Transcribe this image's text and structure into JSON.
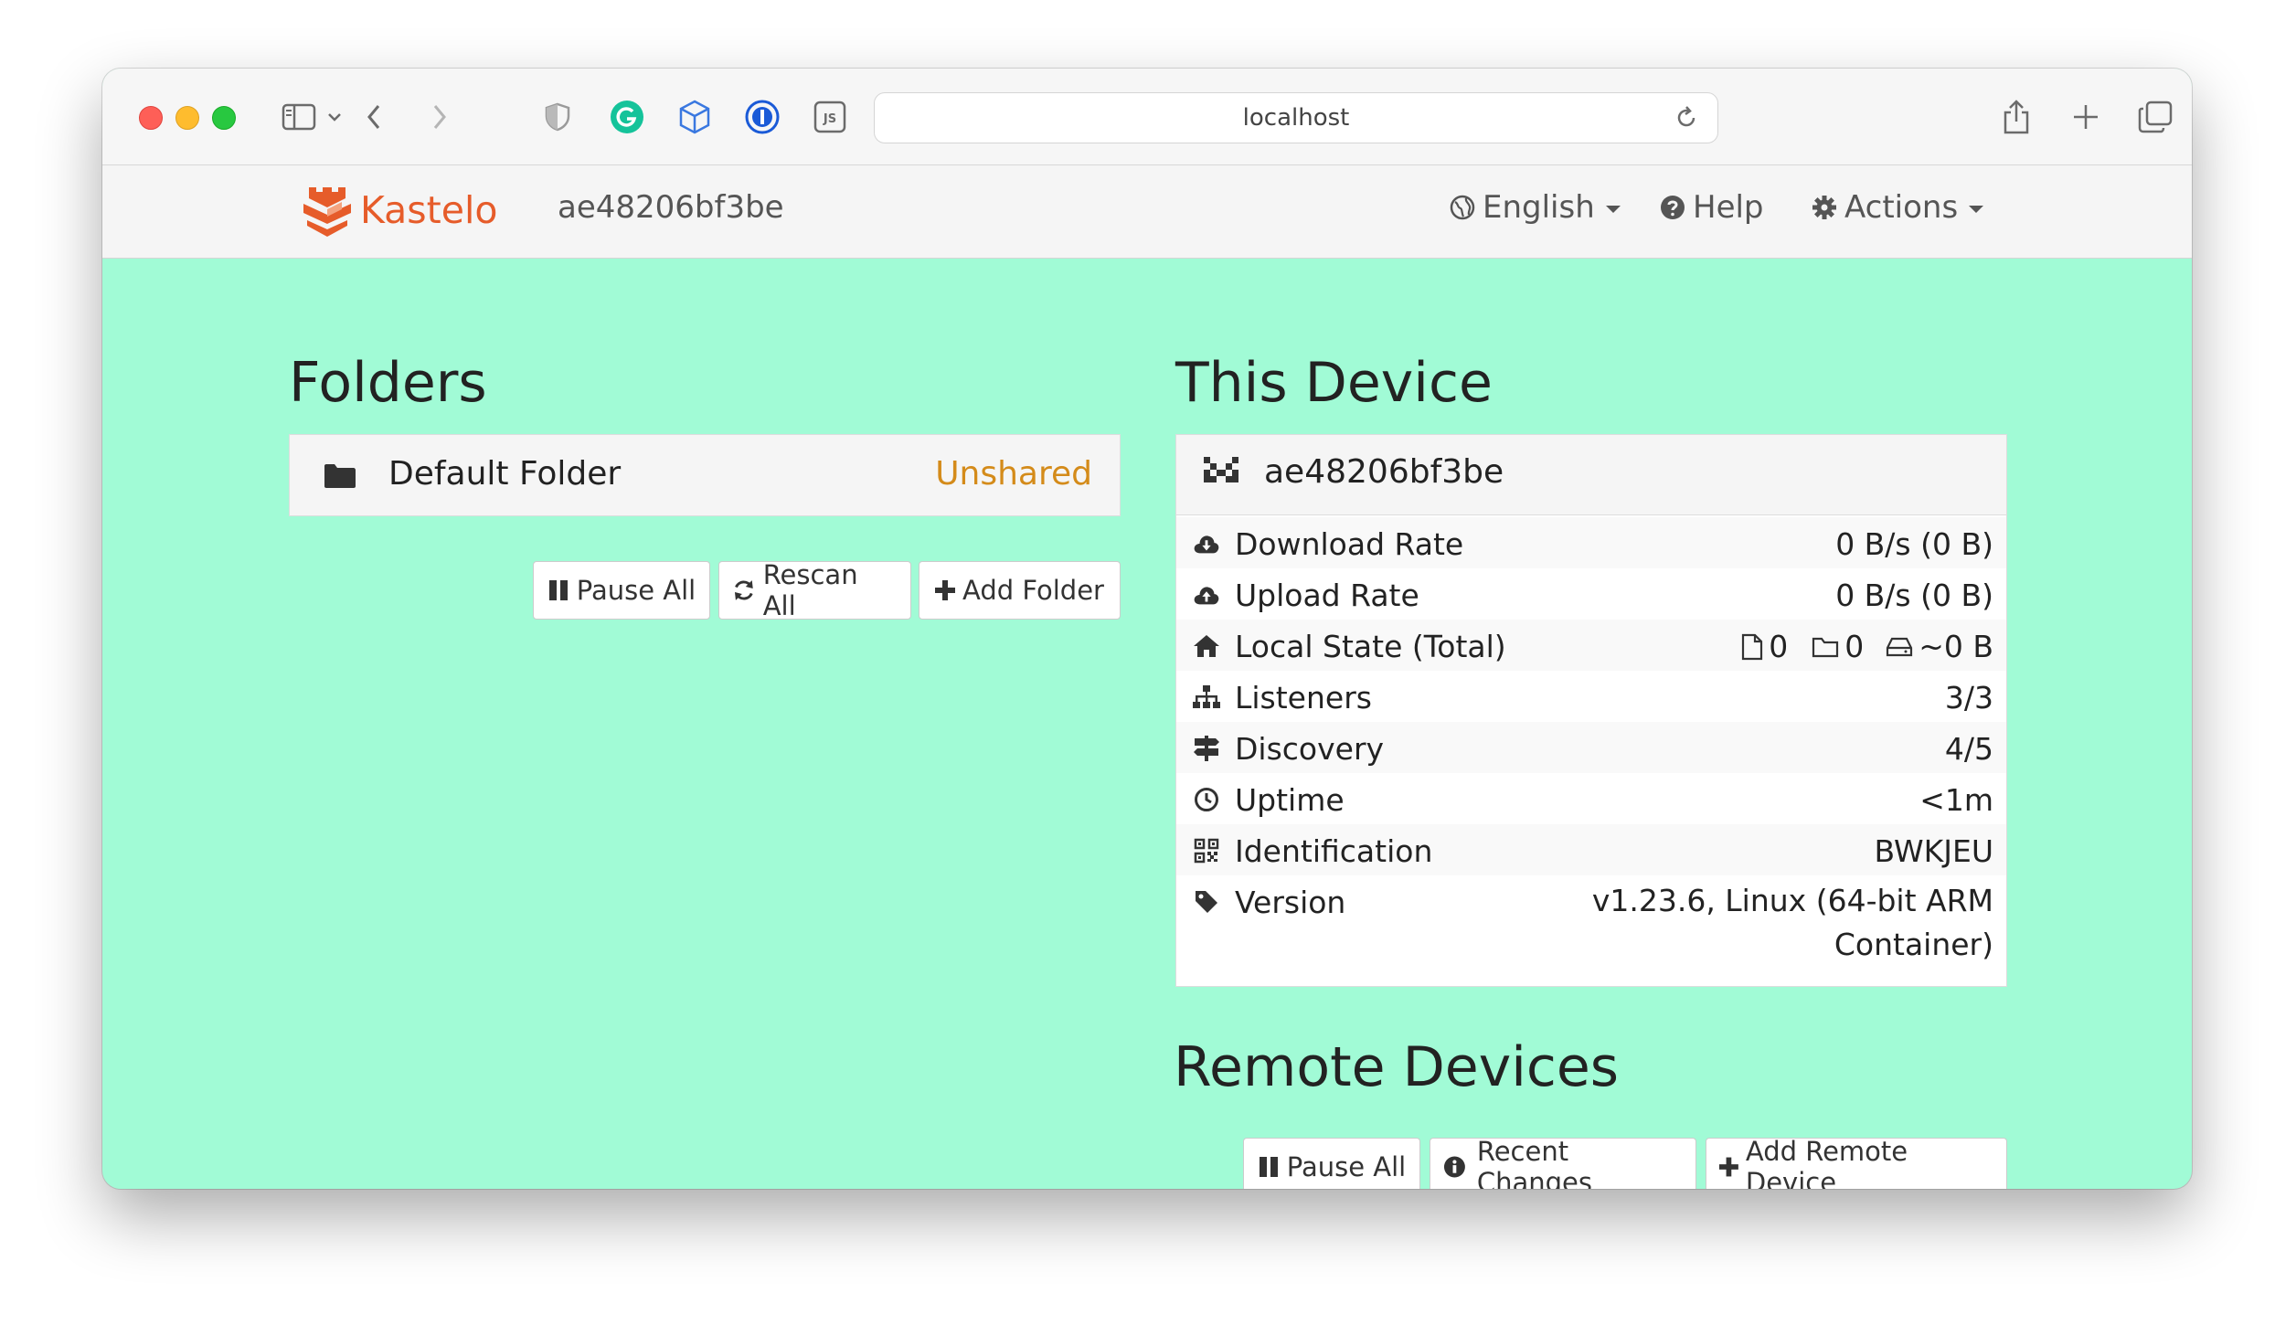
{
  "browser": {
    "url": "localhost"
  },
  "navbar": {
    "brand": "Kastelo",
    "device_name": "ae48206bf3be",
    "language": "English",
    "help": "Help",
    "actions": "Actions"
  },
  "folders": {
    "heading": "Folders",
    "items": [
      {
        "name": "Default Folder",
        "status": "Unshared"
      }
    ],
    "buttons": {
      "pause_all": "Pause All",
      "rescan_all": "Rescan All",
      "add_folder": "Add Folder"
    }
  },
  "this_device": {
    "heading": "This Device",
    "name": "ae48206bf3be",
    "rows": {
      "download_rate": {
        "label": "Download Rate",
        "value": "0 B/s (0 B)"
      },
      "upload_rate": {
        "label": "Upload Rate",
        "value": "0 B/s (0 B)"
      },
      "local_state": {
        "label": "Local State (Total)",
        "files": "0",
        "dirs": "0",
        "size": "~0 B"
      },
      "listeners": {
        "label": "Listeners",
        "value": "3/3"
      },
      "discovery": {
        "label": "Discovery",
        "value": "4/5"
      },
      "uptime": {
        "label": "Uptime",
        "value": "<1m"
      },
      "identification": {
        "label": "Identification",
        "value": "BWKJEU"
      },
      "version": {
        "label": "Version",
        "value_line1": "v1.23.6, Linux (64-bit ARM",
        "value_line2": "Container)"
      }
    }
  },
  "remote_devices": {
    "heading": "Remote Devices",
    "buttons": {
      "pause_all": "Pause All",
      "recent_changes": "Recent Changes",
      "add_remote_device": "Add Remote Device"
    }
  },
  "colors": {
    "background": "#a1fbd6",
    "brand": "#e65c2a",
    "unshared": "#d48b1a",
    "ok": "#4cae4c",
    "link": "#428bca"
  }
}
